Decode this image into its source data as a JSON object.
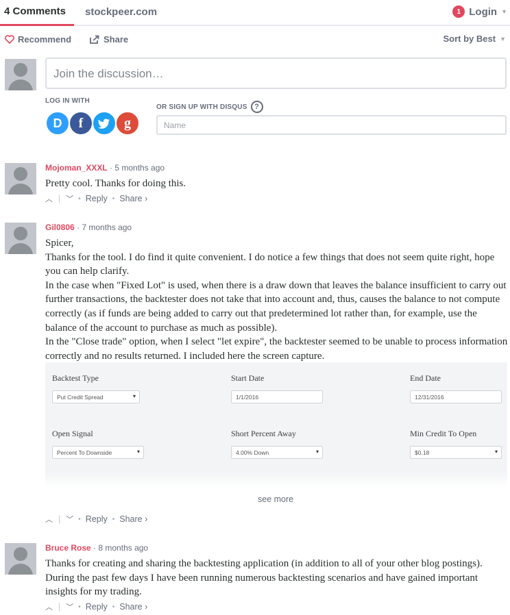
{
  "topnav": {
    "comments_tab": "4 Comments",
    "site_tab": "stockpeer.com",
    "login_badge": "1",
    "login_label": "Login"
  },
  "actionbar": {
    "recommend_label": "Recommend",
    "share_label": "Share",
    "sort_label": "Sort by Best"
  },
  "composer": {
    "placeholder": "Join the discussion…",
    "login_with_label": "LOG IN WITH",
    "signup_label": "OR SIGN UP WITH DISQUS",
    "help_glyph": "?",
    "name_placeholder": "Name",
    "social": [
      {
        "letter": "D",
        "color": "#2e9fff",
        "name": "disqus"
      },
      {
        "letter": "f",
        "color": "#3b5998",
        "name": "facebook"
      },
      {
        "letter": "t",
        "color": "#1da1f2",
        "name": "twitter"
      },
      {
        "letter": "g",
        "color": "#dd4b39",
        "name": "google"
      }
    ]
  },
  "actions": {
    "upvote": "^",
    "downvote": "v",
    "reply": "Reply",
    "share": "Share ›"
  },
  "comments": [
    {
      "author": "Mojoman_XXXL",
      "time": "· 5 months ago",
      "body": [
        "Pretty cool. Thanks for doing this."
      ]
    },
    {
      "author": "Gil0806",
      "time": "· 7 months ago",
      "body": [
        "Spicer,",
        "Thanks for the tool. I do find it quite convenient. I do notice a few things that does not seem quite right, hope you can help clarify.",
        "In the case when \"Fixed Lot\" is used, when there is a draw down that leaves the balance insufficient to carry out further transactions, the backtester does not take that into account and, thus, causes the balance to not compute correctly (as if funds are being added to carry out that predetermined lot rather than, for example, use the balance of the account to purchase as much as possible).",
        "In the \"Close trade\" option, when I select \"let expire\", the backtester seemed to be unable to process information correctly and no results returned. I included here the screen capture."
      ],
      "embed": {
        "backtest_type_label": "Backtest Type",
        "backtest_type_value": "Put Credit Spread",
        "start_date_label": "Start Date",
        "start_date_value": "1/1/2016",
        "end_date_label": "End Date",
        "end_date_value": "12/31/2016",
        "open_signal_label": "Open Signal",
        "open_signal_value": "Percent To Downside",
        "short_percent_label": "Short Percent Away",
        "short_percent_value": "4.00% Down",
        "min_credit_label": "Min Credit To Open",
        "min_credit_value": "$0.18"
      },
      "see_more": "see more"
    },
    {
      "author": "Bruce Rose",
      "time": "· 8 months ago",
      "body": [
        "Thanks for creating and sharing the backtesting application (in addition to all of your other blog postings). During the past few days I have been running numerous backtesting scenarios and have gained important insights for my trading."
      ]
    }
  ]
}
